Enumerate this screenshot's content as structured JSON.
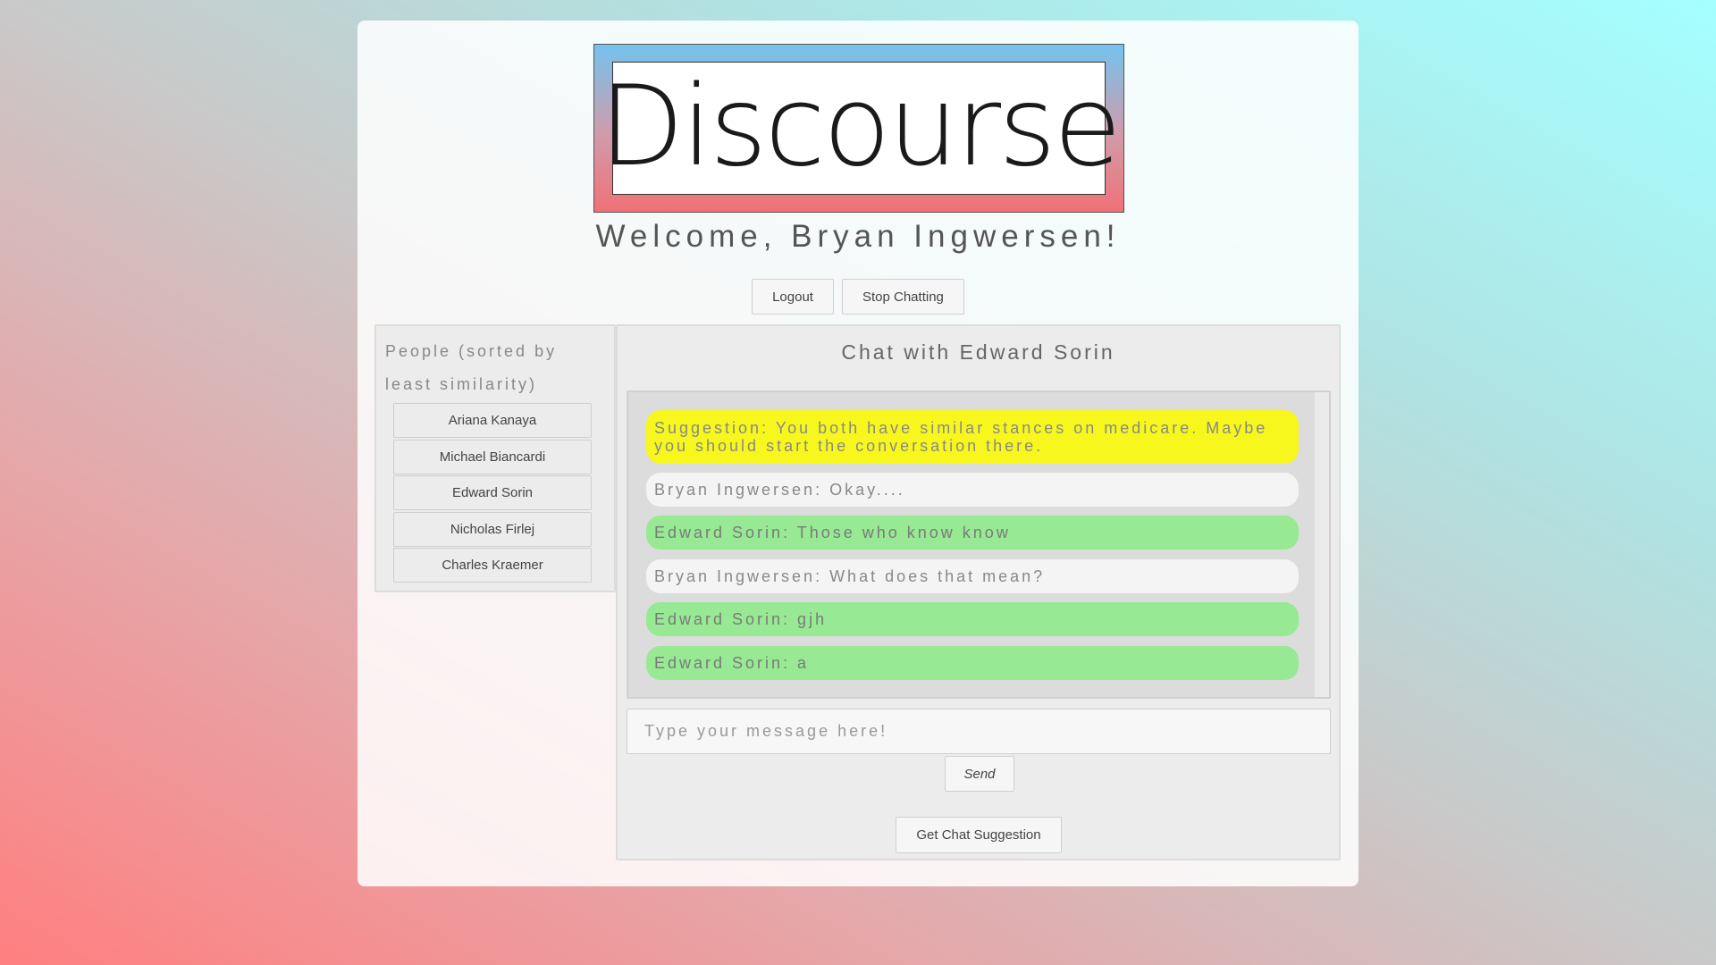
{
  "logo": {
    "text": "Discourse"
  },
  "welcome": "Welcome, Bryan Ingwersen!",
  "top_buttons": {
    "logout": "Logout",
    "stop": "Stop Chatting"
  },
  "people": {
    "title": "People (sorted by least similarity)",
    "items": [
      "Ariana Kanaya",
      "Michael Biancardi",
      "Edward Sorin",
      "Nicholas Firlej",
      "Charles Kraemer"
    ]
  },
  "chat": {
    "title": "Chat with Edward Sorin",
    "messages": [
      {
        "kind": "suggestion",
        "text": "Suggestion: You both have similar stances on medicare. Maybe you should start the conversation there."
      },
      {
        "kind": "me",
        "text": "Bryan Ingwersen: Okay...."
      },
      {
        "kind": "other",
        "text": "Edward Sorin: Those who know know"
      },
      {
        "kind": "me",
        "text": "Bryan Ingwersen: What does that mean?"
      },
      {
        "kind": "other",
        "text": "Edward Sorin: gjh"
      },
      {
        "kind": "other",
        "text": "Edward Sorin: a"
      }
    ],
    "input_placeholder": "Type your message here!",
    "send_label": "Send",
    "suggestion_label": "Get Chat Suggestion"
  },
  "colors": {
    "suggestion": "#f7f71d",
    "my_message": "#f4f4f4",
    "their_message": "#97e994"
  }
}
